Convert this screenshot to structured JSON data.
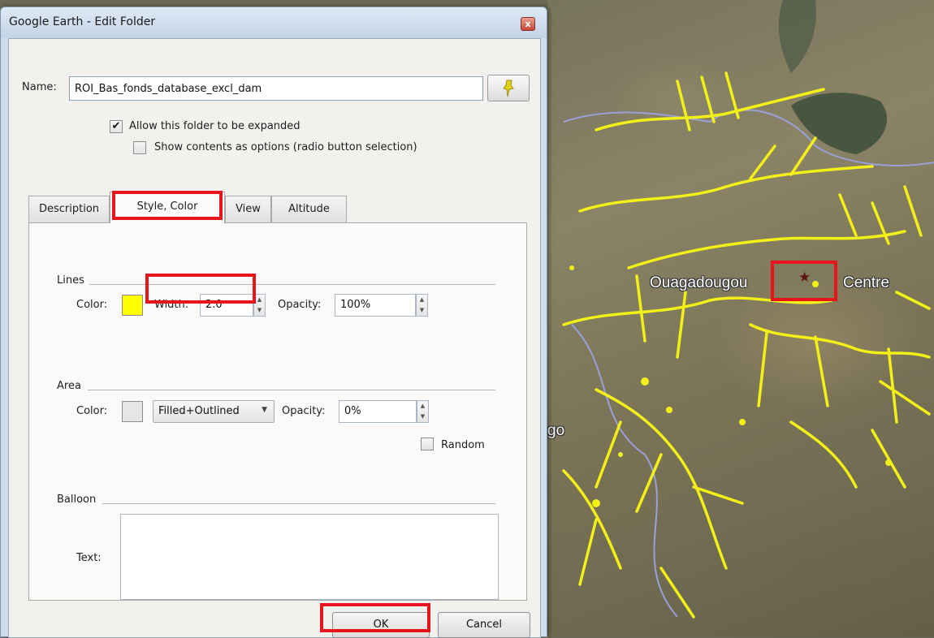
{
  "window": {
    "title": "Google Earth - Edit Folder",
    "close_glyph": "x"
  },
  "name": {
    "label": "Name:",
    "value": "ROI_Bas_fonds_database_excl_dam",
    "pin_icon": "pushpin-icon"
  },
  "options": {
    "allow_expand": {
      "label": "Allow this folder to be expanded",
      "checked": true
    },
    "show_radio": {
      "label": "Show contents as options (radio button selection)",
      "checked": false
    }
  },
  "tabs": [
    {
      "label": "Description",
      "active": false
    },
    {
      "label": "Style, Color",
      "active": true
    },
    {
      "label": "View",
      "active": false
    },
    {
      "label": "Altitude",
      "active": false
    }
  ],
  "lines": {
    "heading": "Lines",
    "color_label": "Color:",
    "color": "#ffff00",
    "width_label": "Width:",
    "width_value": "2.0",
    "opacity_label": "Opacity:",
    "opacity_value": "100%"
  },
  "area": {
    "heading": "Area",
    "color_label": "Color:",
    "color": "#e6e6e6",
    "fill_mode": "Filled+Outlined",
    "opacity_label": "Opacity:",
    "opacity_value": "0%",
    "random_label": "Random",
    "random_checked": false
  },
  "balloon": {
    "heading": "Balloon",
    "text_label": "Text:",
    "text_value": ""
  },
  "buttons": {
    "ok": "OK",
    "cancel": "Cancel"
  },
  "map": {
    "labels": {
      "city": "Ouagadougou",
      "region": "Centre",
      "left_edge": "go"
    },
    "feature_color": "#f3f018",
    "marker_icon": "star-icon"
  }
}
